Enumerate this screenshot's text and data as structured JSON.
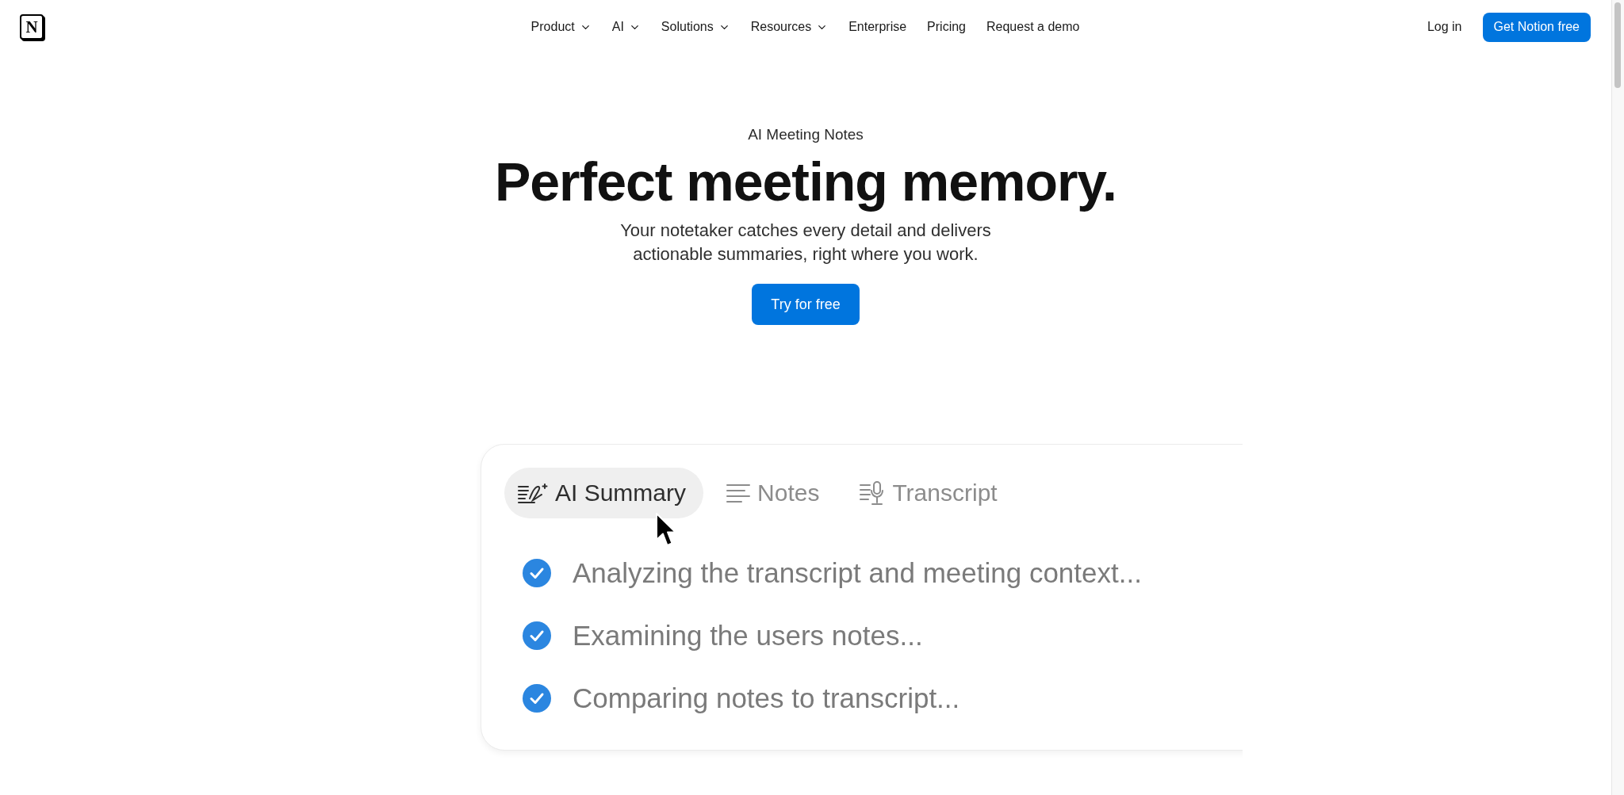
{
  "logo": {
    "letter": "N"
  },
  "nav": {
    "links": [
      {
        "label": "Product",
        "dropdown": true
      },
      {
        "label": "AI",
        "dropdown": true
      },
      {
        "label": "Solutions",
        "dropdown": true
      },
      {
        "label": "Resources",
        "dropdown": true
      },
      {
        "label": "Enterprise",
        "dropdown": false
      },
      {
        "label": "Pricing",
        "dropdown": false
      },
      {
        "label": "Request a demo",
        "dropdown": false
      }
    ],
    "login": "Log in",
    "cta": "Get Notion free"
  },
  "hero": {
    "eyebrow": "AI Meeting Notes",
    "title": "Perfect meeting memory.",
    "subtitle": "Your notetaker catches every detail and delivers actionable summaries, right where you work.",
    "button": "Try for free"
  },
  "demo": {
    "tabs": [
      {
        "kind": "summary",
        "label": "AI Summary",
        "selected": true
      },
      {
        "kind": "notes",
        "label": "Notes",
        "selected": false
      },
      {
        "kind": "transcript",
        "label": "Transcript",
        "selected": false
      }
    ],
    "steps": [
      {
        "text": "Analyzing the transcript and meeting context...",
        "checked": true
      },
      {
        "text": "Examining the users notes...",
        "checked": true
      },
      {
        "text": "Comparing notes to transcript...",
        "checked": true
      }
    ]
  }
}
